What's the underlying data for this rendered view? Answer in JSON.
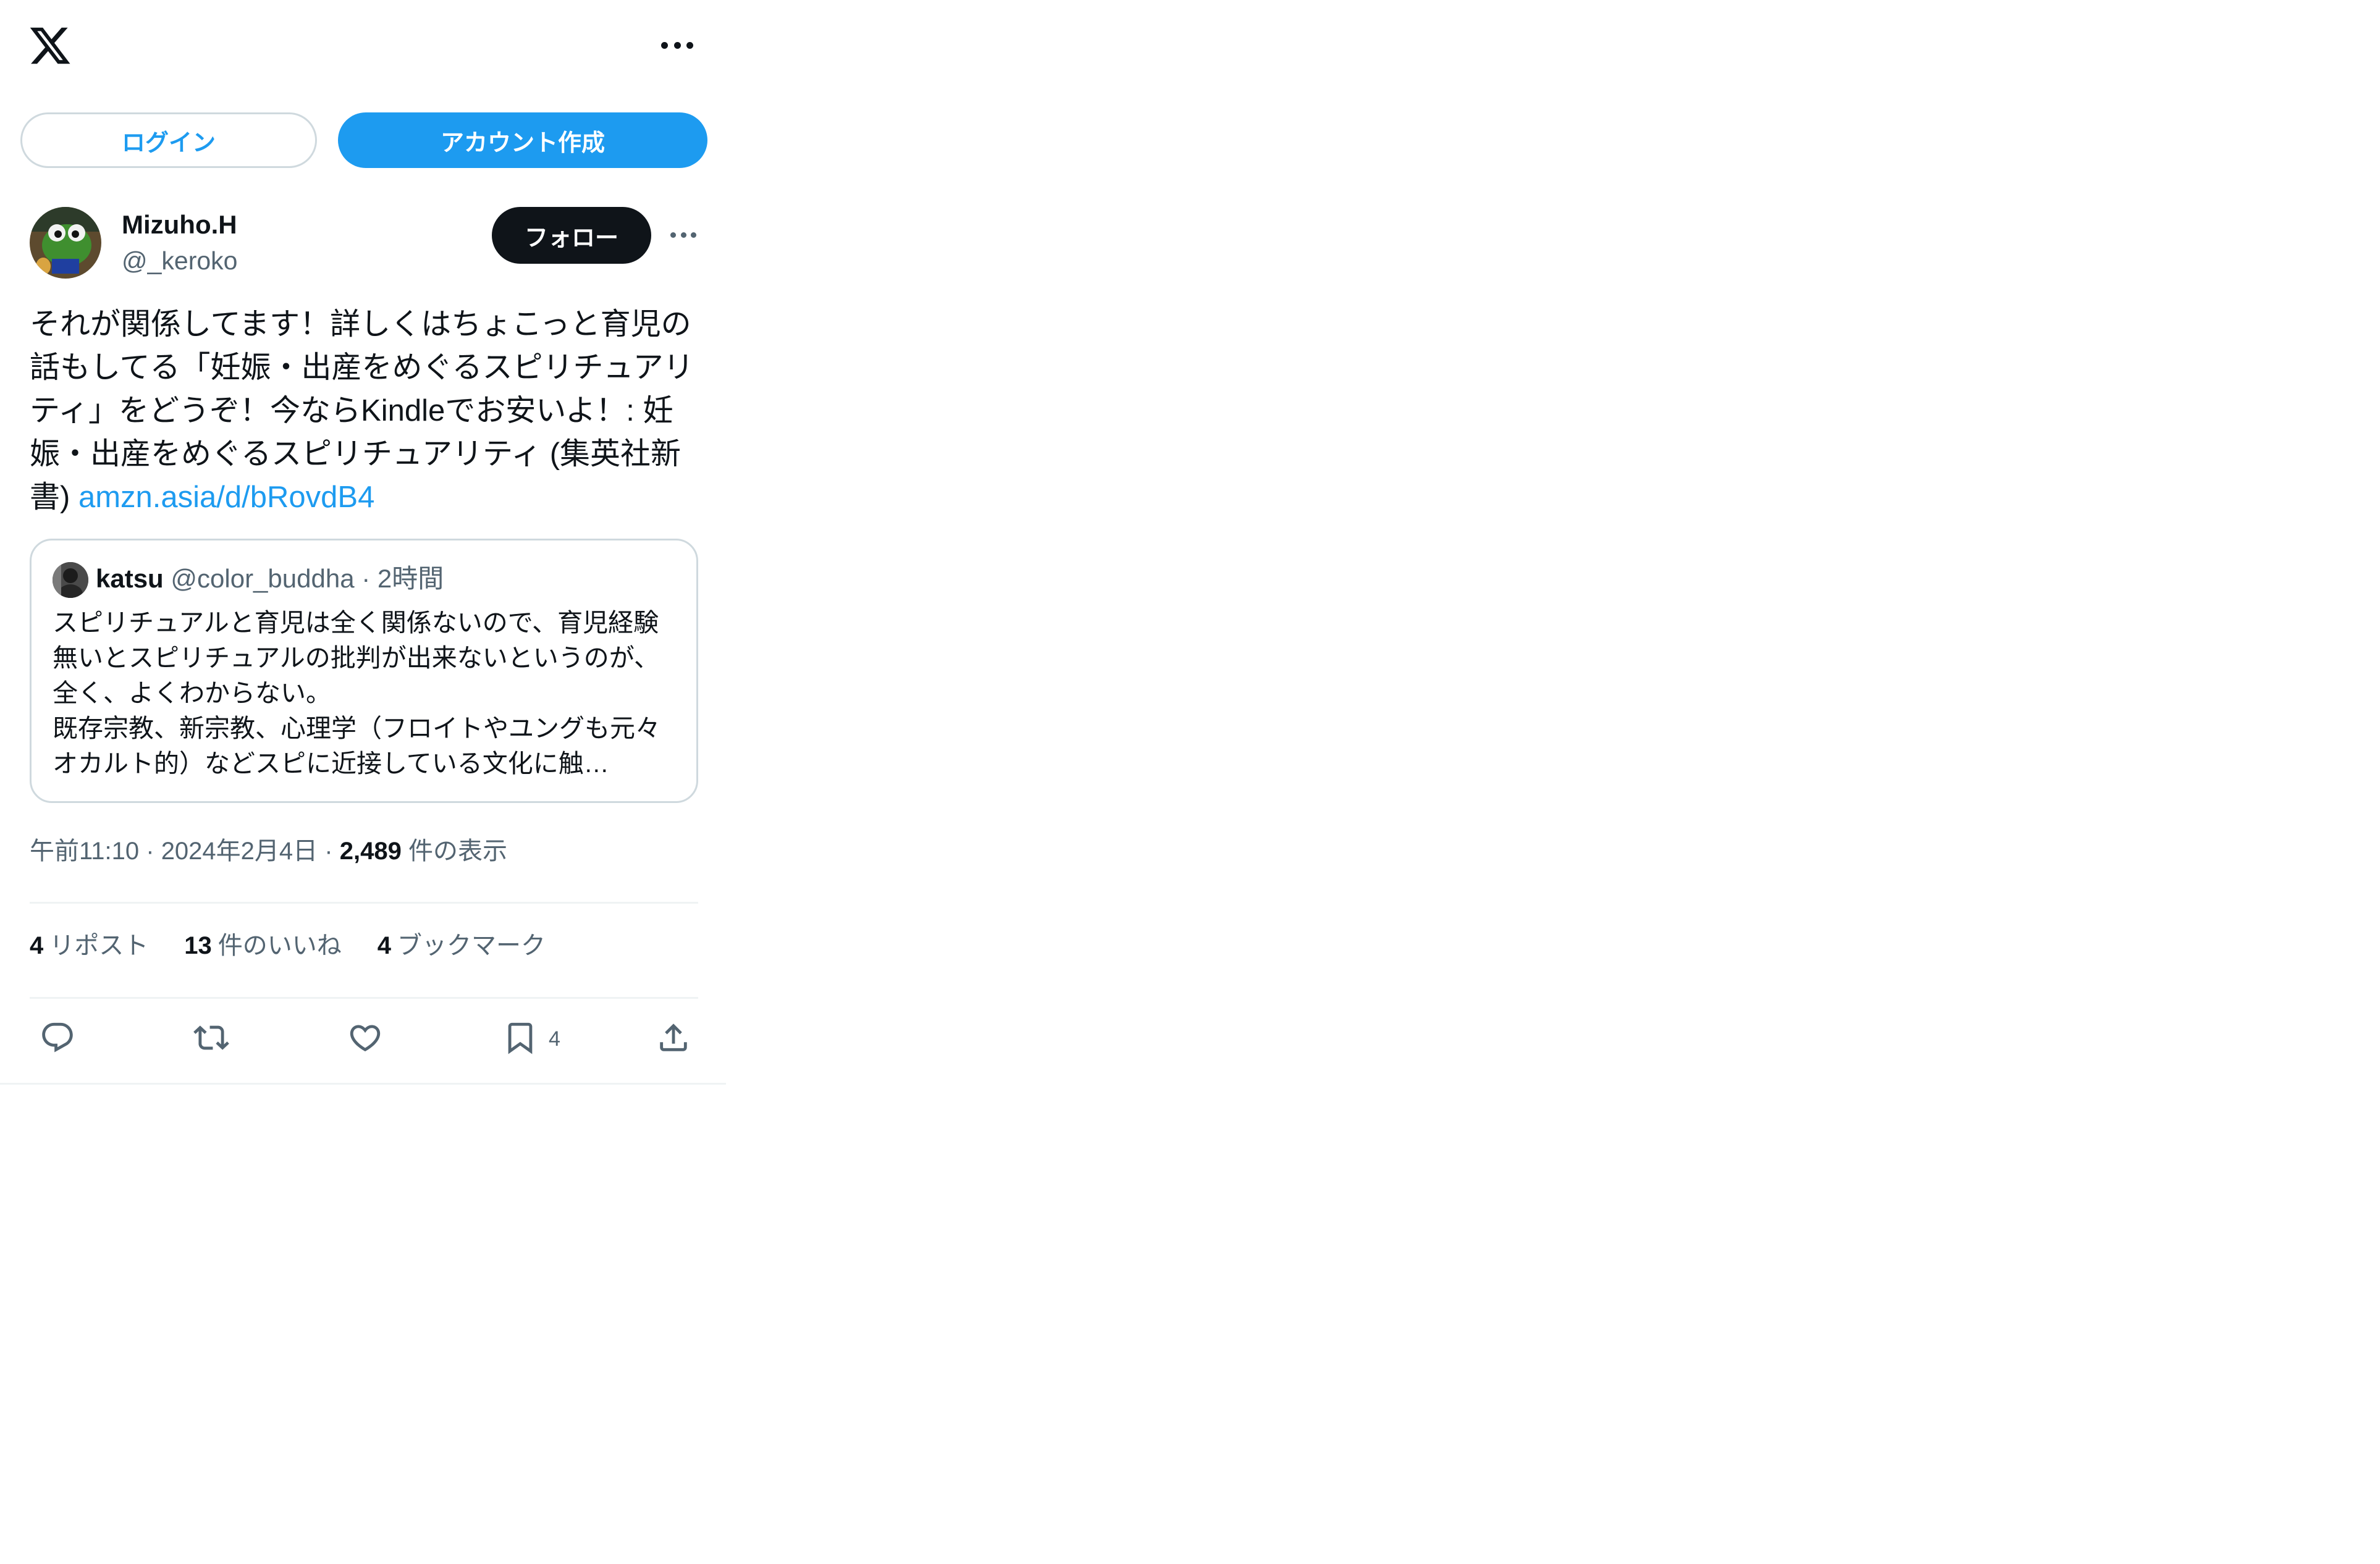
{
  "header": {
    "logo_icon": "x-logo-icon",
    "more_icon": "more-horizontal-icon"
  },
  "auth": {
    "login_label": "ログイン",
    "signup_label": "アカウント作成"
  },
  "tweet": {
    "author_name": "Mizuho.H",
    "author_handle": "@_keroko",
    "follow_label": "フォロー",
    "text_main": "それが関係してます！詳しくはちょこっと育児の話もしてる「妊娠・出産をめぐるスピリチュアリティ」をどうぞ！今ならKindleでお安いよ！: 妊娠・出産をめぐるスピリチュアリティ (集英社新書) ",
    "link_text": "amzn.asia/d/bRovdB4",
    "quote": {
      "name": "katsu",
      "handle": "@color_buddha",
      "separator": " · ",
      "time": "2時間",
      "body": "スピリチュアルと育児は全く関係ないので、育児経験無いとスピリチュアルの批判が出来ないというのが、全く、よくわからない。\n既存宗教、新宗教、心理学（フロイトやユングも元々オカルト的）などスピに近接している文化に触…"
    },
    "time": "午前11:10",
    "date": "2024年2月4日",
    "views_count": "2,489",
    "views_label": " 件の表示",
    "dot": " · "
  },
  "stats": {
    "reposts_count": "4",
    "reposts_label": "リポスト",
    "likes_count": "13",
    "likes_label": "件のいいね",
    "bookmarks_count": "4",
    "bookmarks_label": "ブックマーク"
  },
  "actions": {
    "reply_icon": "reply-icon",
    "repost_icon": "repost-icon",
    "like_icon": "heart-icon",
    "bookmark_icon": "bookmark-icon",
    "bookmark_count": "4",
    "share_icon": "share-icon"
  },
  "colors": {
    "accent": "#1d9bf0",
    "text": "#0f1419",
    "muted": "#536471",
    "border": "#cfd9de"
  }
}
